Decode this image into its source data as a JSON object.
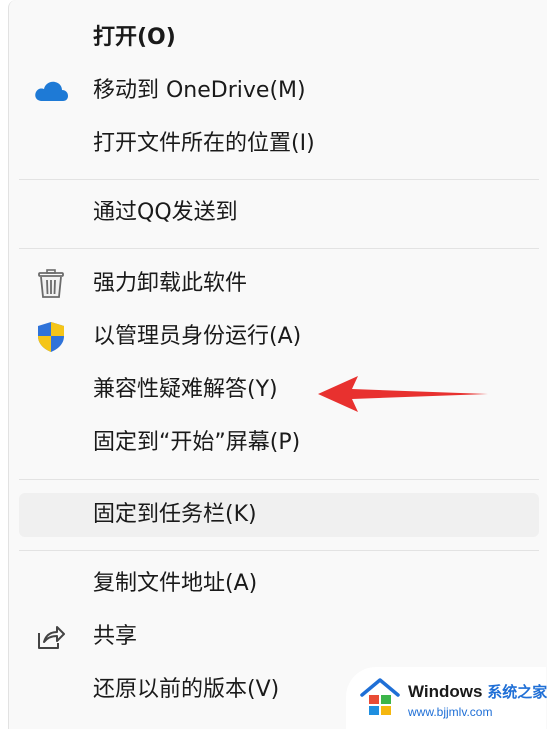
{
  "menu": {
    "items": [
      {
        "label": "打开(O)",
        "icon": "none"
      },
      {
        "label": "移动到 OneDrive(M)",
        "icon": "onedrive-cloud-icon"
      },
      {
        "label": "打开文件所在的位置(I)",
        "icon": "none"
      },
      {
        "label": "通过QQ发送到",
        "icon": "none"
      },
      {
        "label": "强力卸载此软件",
        "icon": "trash-icon"
      },
      {
        "label": "以管理员身份运行(A)",
        "icon": "uac-shield-icon"
      },
      {
        "label": "兼容性疑难解答(Y)",
        "icon": "none"
      },
      {
        "label": "固定到“开始”屏幕(P)",
        "icon": "none"
      },
      {
        "label": "固定到任务栏(K)",
        "icon": "none"
      },
      {
        "label": "复制文件地址(A)",
        "icon": "none"
      },
      {
        "label": "共享",
        "icon": "share-icon"
      },
      {
        "label": "还原以前的版本(V)",
        "icon": "none"
      }
    ],
    "highlighted_index": 8
  },
  "annotation": {
    "type": "red-arrow",
    "color": "#e8312f",
    "points_to": "兼容性疑难解答(Y)"
  },
  "watermark": {
    "title": "Windows",
    "title_cn": "系统之家",
    "url": "www.bjjmlv.com"
  },
  "colors": {
    "onedrive": "#1e7ad6",
    "shield_blue": "#2f73d9",
    "shield_yellow": "#f5c518",
    "arrow_red": "#e8312f"
  }
}
